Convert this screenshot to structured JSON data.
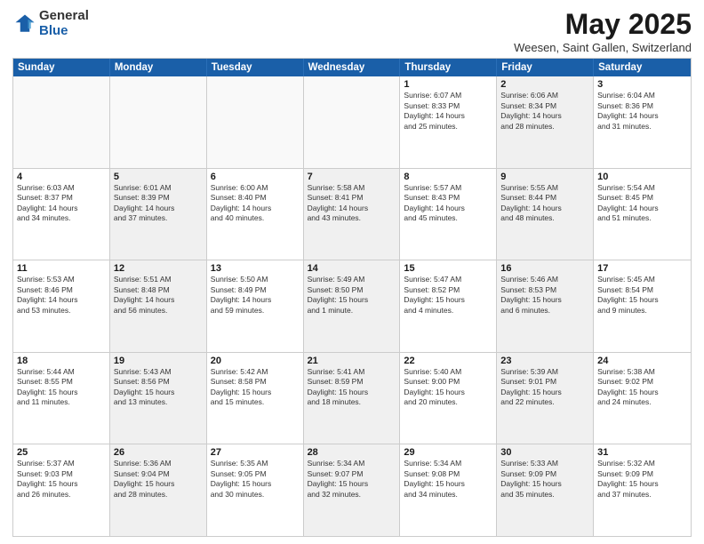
{
  "logo": {
    "general": "General",
    "blue": "Blue"
  },
  "title": {
    "month": "May 2025",
    "location": "Weesen, Saint Gallen, Switzerland"
  },
  "header_days": [
    "Sunday",
    "Monday",
    "Tuesday",
    "Wednesday",
    "Thursday",
    "Friday",
    "Saturday"
  ],
  "rows": [
    [
      {
        "day": "",
        "info": "",
        "empty": true
      },
      {
        "day": "",
        "info": "",
        "empty": true
      },
      {
        "day": "",
        "info": "",
        "empty": true
      },
      {
        "day": "",
        "info": "",
        "empty": true
      },
      {
        "day": "1",
        "info": "Sunrise: 6:07 AM\nSunset: 8:33 PM\nDaylight: 14 hours\nand 25 minutes.",
        "empty": false
      },
      {
        "day": "2",
        "info": "Sunrise: 6:06 AM\nSunset: 8:34 PM\nDaylight: 14 hours\nand 28 minutes.",
        "empty": false,
        "shaded": true
      },
      {
        "day": "3",
        "info": "Sunrise: 6:04 AM\nSunset: 8:36 PM\nDaylight: 14 hours\nand 31 minutes.",
        "empty": false
      }
    ],
    [
      {
        "day": "4",
        "info": "Sunrise: 6:03 AM\nSunset: 8:37 PM\nDaylight: 14 hours\nand 34 minutes.",
        "empty": false
      },
      {
        "day": "5",
        "info": "Sunrise: 6:01 AM\nSunset: 8:39 PM\nDaylight: 14 hours\nand 37 minutes.",
        "empty": false,
        "shaded": true
      },
      {
        "day": "6",
        "info": "Sunrise: 6:00 AM\nSunset: 8:40 PM\nDaylight: 14 hours\nand 40 minutes.",
        "empty": false
      },
      {
        "day": "7",
        "info": "Sunrise: 5:58 AM\nSunset: 8:41 PM\nDaylight: 14 hours\nand 43 minutes.",
        "empty": false,
        "shaded": true
      },
      {
        "day": "8",
        "info": "Sunrise: 5:57 AM\nSunset: 8:43 PM\nDaylight: 14 hours\nand 45 minutes.",
        "empty": false
      },
      {
        "day": "9",
        "info": "Sunrise: 5:55 AM\nSunset: 8:44 PM\nDaylight: 14 hours\nand 48 minutes.",
        "empty": false,
        "shaded": true
      },
      {
        "day": "10",
        "info": "Sunrise: 5:54 AM\nSunset: 8:45 PM\nDaylight: 14 hours\nand 51 minutes.",
        "empty": false
      }
    ],
    [
      {
        "day": "11",
        "info": "Sunrise: 5:53 AM\nSunset: 8:46 PM\nDaylight: 14 hours\nand 53 minutes.",
        "empty": false
      },
      {
        "day": "12",
        "info": "Sunrise: 5:51 AM\nSunset: 8:48 PM\nDaylight: 14 hours\nand 56 minutes.",
        "empty": false,
        "shaded": true
      },
      {
        "day": "13",
        "info": "Sunrise: 5:50 AM\nSunset: 8:49 PM\nDaylight: 14 hours\nand 59 minutes.",
        "empty": false
      },
      {
        "day": "14",
        "info": "Sunrise: 5:49 AM\nSunset: 8:50 PM\nDaylight: 15 hours\nand 1 minute.",
        "empty": false,
        "shaded": true
      },
      {
        "day": "15",
        "info": "Sunrise: 5:47 AM\nSunset: 8:52 PM\nDaylight: 15 hours\nand 4 minutes.",
        "empty": false
      },
      {
        "day": "16",
        "info": "Sunrise: 5:46 AM\nSunset: 8:53 PM\nDaylight: 15 hours\nand 6 minutes.",
        "empty": false,
        "shaded": true
      },
      {
        "day": "17",
        "info": "Sunrise: 5:45 AM\nSunset: 8:54 PM\nDaylight: 15 hours\nand 9 minutes.",
        "empty": false
      }
    ],
    [
      {
        "day": "18",
        "info": "Sunrise: 5:44 AM\nSunset: 8:55 PM\nDaylight: 15 hours\nand 11 minutes.",
        "empty": false
      },
      {
        "day": "19",
        "info": "Sunrise: 5:43 AM\nSunset: 8:56 PM\nDaylight: 15 hours\nand 13 minutes.",
        "empty": false,
        "shaded": true
      },
      {
        "day": "20",
        "info": "Sunrise: 5:42 AM\nSunset: 8:58 PM\nDaylight: 15 hours\nand 15 minutes.",
        "empty": false
      },
      {
        "day": "21",
        "info": "Sunrise: 5:41 AM\nSunset: 8:59 PM\nDaylight: 15 hours\nand 18 minutes.",
        "empty": false,
        "shaded": true
      },
      {
        "day": "22",
        "info": "Sunrise: 5:40 AM\nSunset: 9:00 PM\nDaylight: 15 hours\nand 20 minutes.",
        "empty": false
      },
      {
        "day": "23",
        "info": "Sunrise: 5:39 AM\nSunset: 9:01 PM\nDaylight: 15 hours\nand 22 minutes.",
        "empty": false,
        "shaded": true
      },
      {
        "day": "24",
        "info": "Sunrise: 5:38 AM\nSunset: 9:02 PM\nDaylight: 15 hours\nand 24 minutes.",
        "empty": false
      }
    ],
    [
      {
        "day": "25",
        "info": "Sunrise: 5:37 AM\nSunset: 9:03 PM\nDaylight: 15 hours\nand 26 minutes.",
        "empty": false
      },
      {
        "day": "26",
        "info": "Sunrise: 5:36 AM\nSunset: 9:04 PM\nDaylight: 15 hours\nand 28 minutes.",
        "empty": false,
        "shaded": true
      },
      {
        "day": "27",
        "info": "Sunrise: 5:35 AM\nSunset: 9:05 PM\nDaylight: 15 hours\nand 30 minutes.",
        "empty": false
      },
      {
        "day": "28",
        "info": "Sunrise: 5:34 AM\nSunset: 9:07 PM\nDaylight: 15 hours\nand 32 minutes.",
        "empty": false,
        "shaded": true
      },
      {
        "day": "29",
        "info": "Sunrise: 5:34 AM\nSunset: 9:08 PM\nDaylight: 15 hours\nand 34 minutes.",
        "empty": false
      },
      {
        "day": "30",
        "info": "Sunrise: 5:33 AM\nSunset: 9:09 PM\nDaylight: 15 hours\nand 35 minutes.",
        "empty": false,
        "shaded": true
      },
      {
        "day": "31",
        "info": "Sunrise: 5:32 AM\nSunset: 9:09 PM\nDaylight: 15 hours\nand 37 minutes.",
        "empty": false
      }
    ]
  ]
}
